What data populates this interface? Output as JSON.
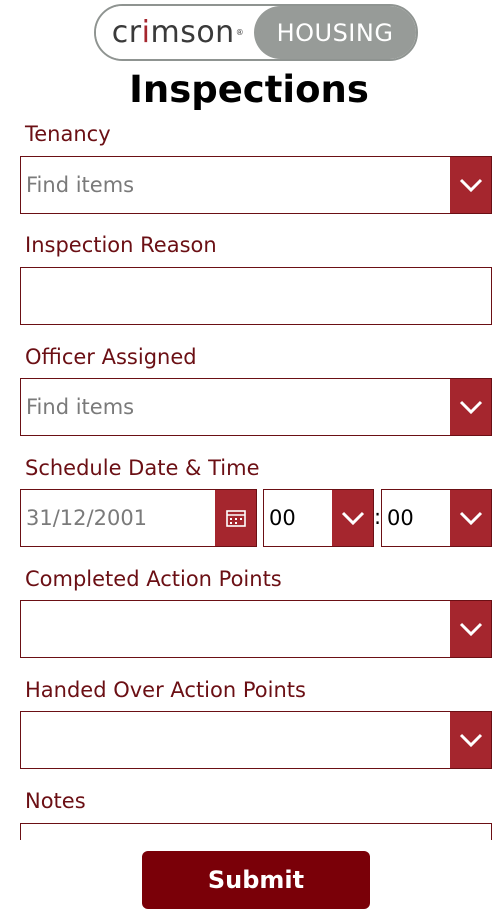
{
  "logo": {
    "brand_pre": "cr",
    "brand_accent": "i",
    "brand_post": "mson",
    "reg": "®",
    "housing": "HOUSING"
  },
  "page": {
    "title": "Inspections"
  },
  "form": {
    "tenancy": {
      "label": "Tenancy",
      "placeholder": "Find items"
    },
    "inspection_reason": {
      "label": "Inspection Reason",
      "value": ""
    },
    "officer_assigned": {
      "label": "Officer Assigned",
      "placeholder": "Find items"
    },
    "schedule": {
      "label": "Schedule Date & Time",
      "date_placeholder": "31/12/2001",
      "hour": "00",
      "separator": ":",
      "minute": "00"
    },
    "completed_action_points": {
      "label": "Completed Action Points",
      "value": ""
    },
    "handed_over_action_points": {
      "label": "Handed Over Action Points",
      "value": ""
    },
    "notes": {
      "label": "Notes"
    }
  },
  "actions": {
    "submit_label": "Submit"
  },
  "colors": {
    "accent": "#a5262e",
    "border": "#6b0f14",
    "label": "#6b0f14",
    "submit": "#7a0008",
    "logo_grey": "#979b98"
  }
}
